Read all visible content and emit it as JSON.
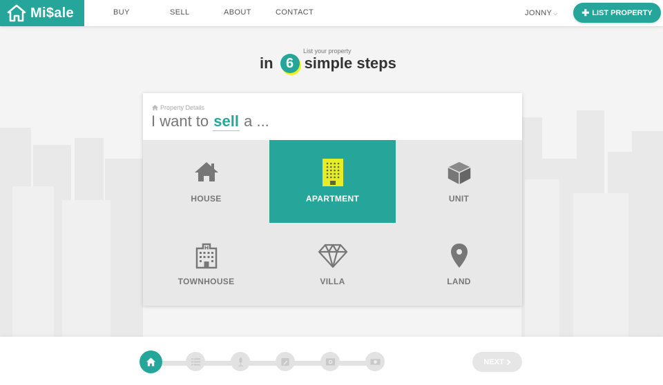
{
  "brand": {
    "name": "Mi$ale",
    "accent": "#26a69a",
    "highlight": "#eef21a"
  },
  "nav": {
    "items": [
      "BUY",
      "SELL",
      "ABOUT",
      "CONTACT"
    ]
  },
  "user": {
    "name": "JONNY",
    "chevron": "chevron-down-icon"
  },
  "header": {
    "list_button": "LIST PROPERTY",
    "list_icon": "plus-icon"
  },
  "headline": {
    "small": "List your property",
    "prefix": "in",
    "step_count": "6",
    "suffix": "simple steps"
  },
  "card": {
    "breadcrumb": "Property Details",
    "breadcrumb_icon": "home-icon",
    "title_prefix": "I want to",
    "title_highlight": "sell",
    "title_suffix": "a ...",
    "options": [
      {
        "label": "HOUSE",
        "icon": "house-icon",
        "selected": false
      },
      {
        "label": "APARTMENT",
        "icon": "apartment-building-icon",
        "selected": true
      },
      {
        "label": "UNIT",
        "icon": "cube-icon",
        "selected": false
      },
      {
        "label": "TOWNHOUSE",
        "icon": "townhouse-building-icon",
        "selected": false
      },
      {
        "label": "VILLA",
        "icon": "diamond-icon",
        "selected": false
      },
      {
        "label": "LAND",
        "icon": "map-pin-icon",
        "selected": false
      }
    ]
  },
  "progress": {
    "steps": [
      "home-icon",
      "list-icon",
      "microphone-icon",
      "edit-icon",
      "photo-icon",
      "money-icon"
    ],
    "current_step": 1,
    "total_steps": 6
  },
  "footer": {
    "next_label": "NEXT",
    "next_icon": "chevron-right-icon"
  }
}
